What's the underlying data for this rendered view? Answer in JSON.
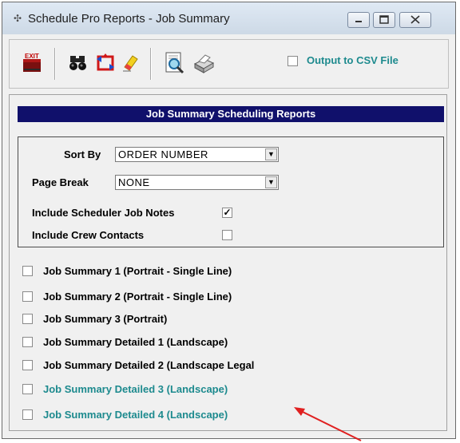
{
  "window": {
    "title": "Schedule Pro Reports - Job Summary",
    "icon": "window-app-icon",
    "controls": {
      "minimize": "minimize-icon",
      "maximize": "maximize-icon",
      "close": "close-icon"
    }
  },
  "toolbar": {
    "exit_label": "EXIT",
    "icons": [
      "exit-icon",
      "binoculars-icon",
      "refresh-icon",
      "eraser-icon",
      "preview-icon",
      "printer-icon"
    ],
    "csv_label": "Output to CSV File",
    "csv_checked": false
  },
  "panel": {
    "banner": "Job Summary Scheduling Reports",
    "sort_by": {
      "label": "Sort By",
      "value": "ORDER NUMBER"
    },
    "page_break": {
      "label": "Page Break",
      "value": "NONE"
    },
    "include_notes": {
      "label": "Include Scheduler Job Notes",
      "checked": true,
      "mark": "✓"
    },
    "include_contacts": {
      "label": "Include Crew Contacts",
      "checked": false
    }
  },
  "reports": [
    {
      "label": "Job Summary 1 (Portrait - Single Line)",
      "checked": false,
      "color": "#000000"
    },
    {
      "label": "Job Summary 2 (Portrait - Single Line)",
      "checked": false,
      "color": "#000000"
    },
    {
      "label": "Job Summary 3 (Portrait)",
      "checked": false,
      "color": "#000000"
    },
    {
      "label": "Job Summary Detailed 1 (Landscape)",
      "checked": false,
      "color": "#000000"
    },
    {
      "label": "Job Summary Detailed 2 (Landscape Legal",
      "checked": false,
      "color": "#000000"
    },
    {
      "label": "Job Summary Detailed 3 (Landscape)",
      "checked": false,
      "color": "#1d8a8e"
    },
    {
      "label": "Job Summary Detailed 4 (Landscape)",
      "checked": false,
      "color": "#1d8a8e"
    }
  ],
  "colors": {
    "banner_bg": "#10106b",
    "accent_teal": "#1d8a8e",
    "arrow": "#e02020"
  }
}
